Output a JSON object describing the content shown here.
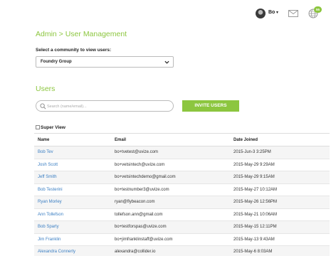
{
  "header": {
    "user_name": "Bo",
    "caret": "▾",
    "notification_count": "55",
    "icons": [
      "avatar",
      "mail-icon",
      "globe-icon"
    ]
  },
  "page": {
    "title": "Admin > User Management",
    "community_label": "Select a community to view users:",
    "community_selected": "Foundry Group",
    "users_heading": "Users",
    "search_placeholder": "Search (name/email)...",
    "invite_label": "INVITE USERS",
    "super_view_label": "Super View"
  },
  "colors": {
    "accent": "#8cc63f",
    "link": "#3a7ec3"
  },
  "table": {
    "columns": [
      "Name",
      "Email",
      "Date Joined"
    ],
    "rows": [
      [
        "Bob Tev",
        "bo+tvetest@uvize.com",
        "2015-Jun-3 3:25PM"
      ],
      [
        "Josh Scott",
        "bo+vetsintech@uvize.com",
        "2015-May-29 9:29AM"
      ],
      [
        "Jeff Smith",
        "bo+vetsintechdemo@gmail.com",
        "2015-May-29 9:15AM"
      ],
      [
        "Bob Testerini",
        "bo+testnumber3@uvize.com",
        "2015-May-27 10:12AM"
      ],
      [
        "Ryan Morley",
        "ryan@flybeacon.com",
        "2015-May-26 12:56PM"
      ],
      [
        "Ann Tollefson",
        "tollefson.ann@gmail.com",
        "2015-May-21 10:06AM"
      ],
      [
        "Bob Sparty",
        "bo+testforspas@uvize.com",
        "2015-May-15 12:11PM"
      ],
      [
        "Jim Franklin",
        "bo+jimfranklinstaff@uvize.com",
        "2015-May-13 9:43AM"
      ],
      [
        "Alexandra Connerty",
        "alexandra@collider.io",
        "2015-May-6 8:03AM"
      ]
    ]
  }
}
